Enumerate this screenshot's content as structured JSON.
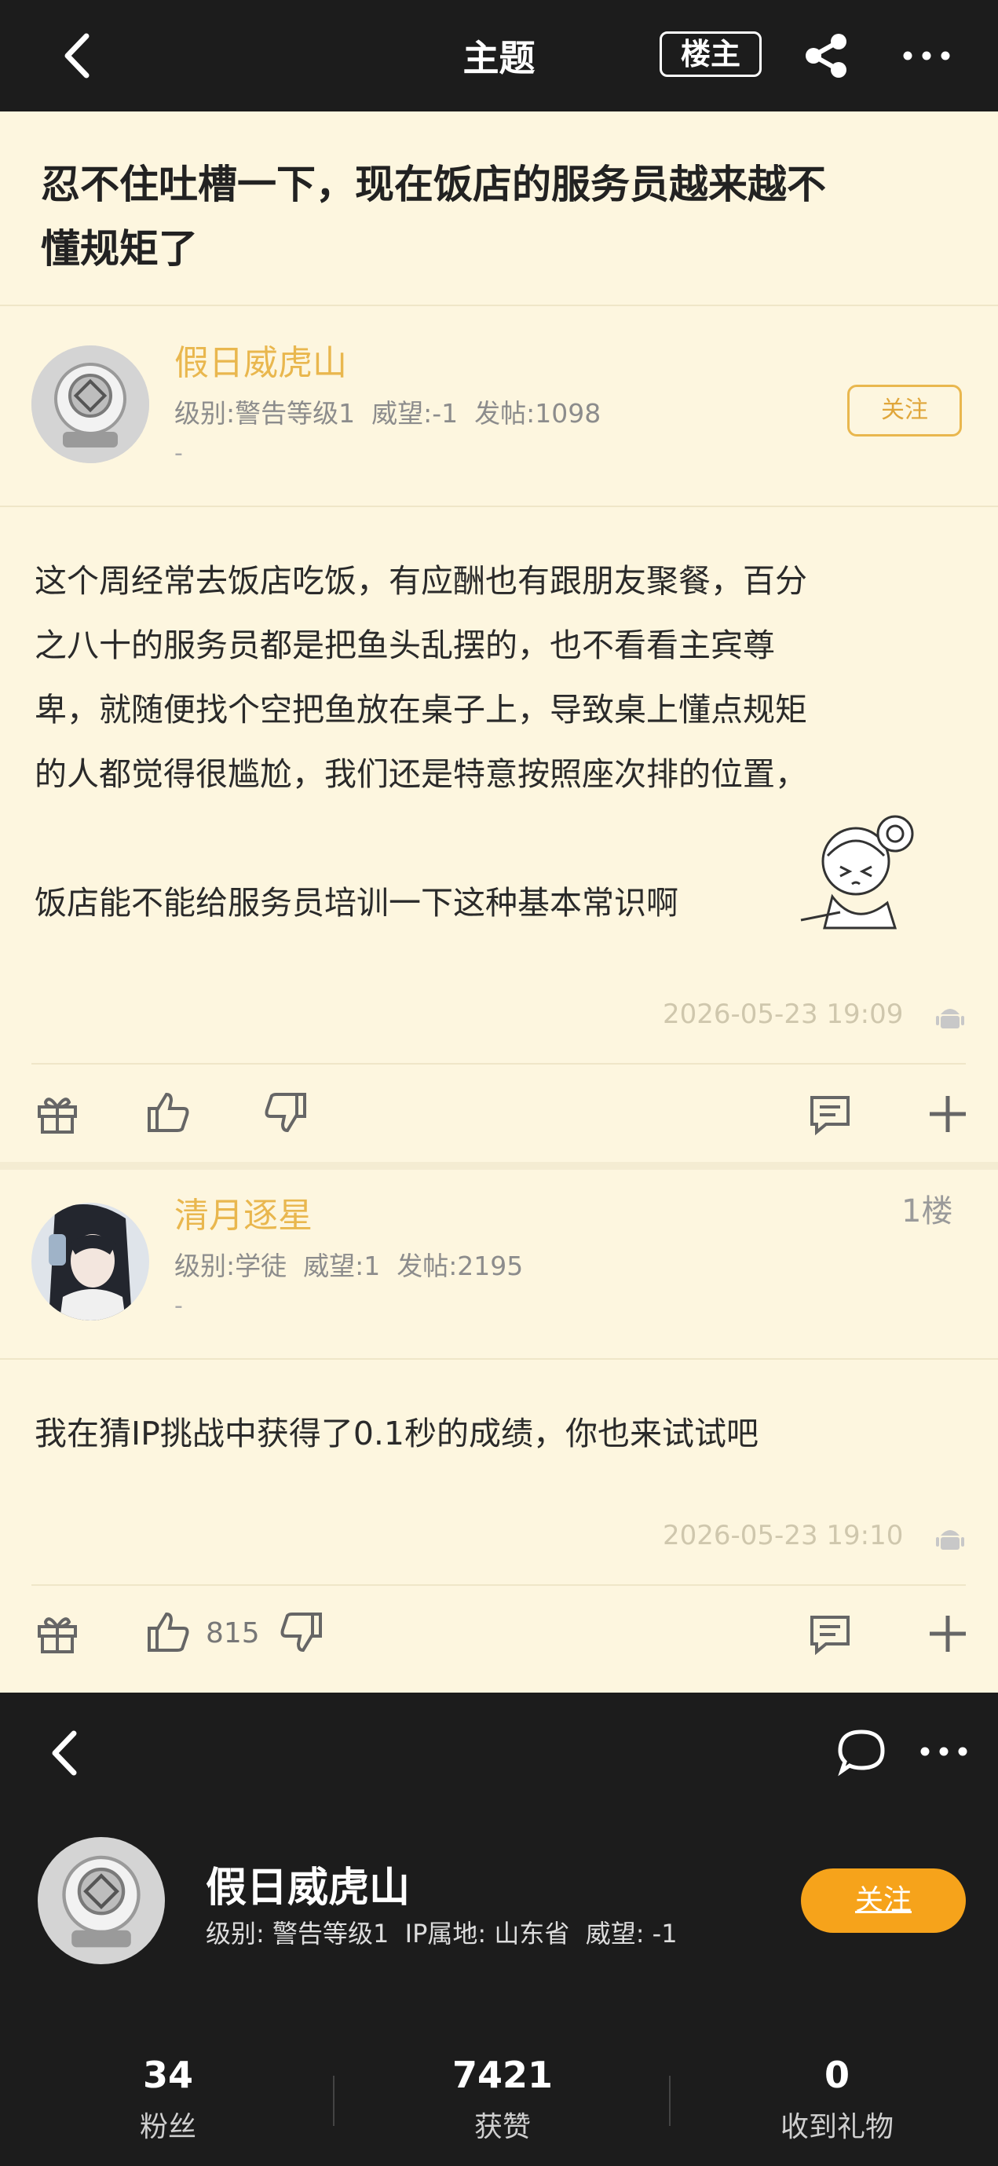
{
  "topbar": {
    "title": "主题",
    "owner_button": "楼主"
  },
  "thread": {
    "title_lines": [
      "忍不住吐槽一下，现在饭店的服务员越来越不",
      "懂规矩了"
    ],
    "op": {
      "name": "假日威虎山",
      "meta": "级别:警告等级1  威望:-1  发帖:1098",
      "dash": "-",
      "follow_label": "关注",
      "body_lines": [
        "这个周经常去饭店吃饭，有应酬也有跟朋友聚餐，百分",
        "之八十的服务员都是把鱼头乱摆的，也不看看主宾尊",
        "卑，就随便找个空把鱼放在桌子上，导致桌上懂点规矩",
        "的人都觉得很尴尬，我们还是特意按照座次排的位置，",
        "饭店能不能给服务员培训一下这种基本常识啊"
      ],
      "timestamp": "2026-05-23 19:09"
    },
    "reply": {
      "name": "清月逐星",
      "meta": "级别:学徒  威望:1  发帖:2195",
      "dash": "-",
      "floor": "1楼",
      "body": "我在猜IP挑战中获得了0.1秒的成绩，你也来试试吧",
      "timestamp": "2026-05-23 19:10",
      "like_count": "815"
    }
  },
  "profile": {
    "name": "假日威虎山",
    "meta": "级别: 警告等级1  IP属地: 山东省  威望: -1",
    "follow_label": "关注",
    "stats": [
      {
        "value": "34",
        "label": "粉丝"
      },
      {
        "value": "7421",
        "label": "获赞"
      },
      {
        "value": "0",
        "label": "收到礼物"
      }
    ]
  },
  "colors": {
    "accent": "#e9b74e",
    "follow_orange": "#f6a31b",
    "background": "#fdf6df",
    "dark": "#1c1c1c"
  }
}
